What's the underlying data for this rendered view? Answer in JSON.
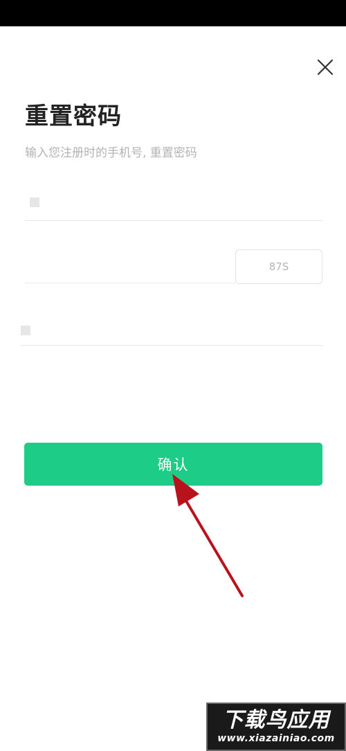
{
  "header": {
    "title": "重置密码",
    "subtitle": "输入您注册时的手机号, 重置密码"
  },
  "form": {
    "phone": {
      "value": "",
      "placeholder": ""
    },
    "code": {
      "value": "",
      "placeholder": "",
      "send_button_label": "87S"
    },
    "password": {
      "value": "",
      "placeholder": ""
    },
    "confirm_label": "确认"
  },
  "icons": {
    "close": "close-icon",
    "annotation": "red-arrow"
  },
  "colors": {
    "accent": "#1dcd87",
    "arrow": "#b8131c",
    "title": "#222222",
    "subtitle": "#b3b3b3"
  },
  "watermark": {
    "main": "下载鸟应用",
    "sub": "www.xiazainiao.com"
  }
}
